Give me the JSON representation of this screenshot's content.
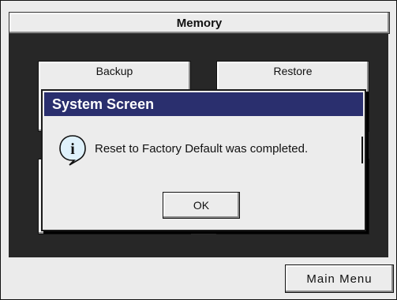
{
  "window": {
    "title": "Memory"
  },
  "menu": {
    "buttons": [
      {
        "label": "Backup"
      },
      {
        "label": "Restore"
      },
      {
        "label": ""
      },
      {
        "label": ""
      }
    ]
  },
  "footer": {
    "main_menu_label": "Main Menu"
  },
  "dialog": {
    "title": "System Screen",
    "message": "Reset to Factory Default was completed.",
    "ok_label": "OK",
    "icon": "info-icon"
  },
  "colors": {
    "dialog_title_bg": "#2a2f6e",
    "background_dark": "#272727",
    "button_face": "#ececec"
  }
}
